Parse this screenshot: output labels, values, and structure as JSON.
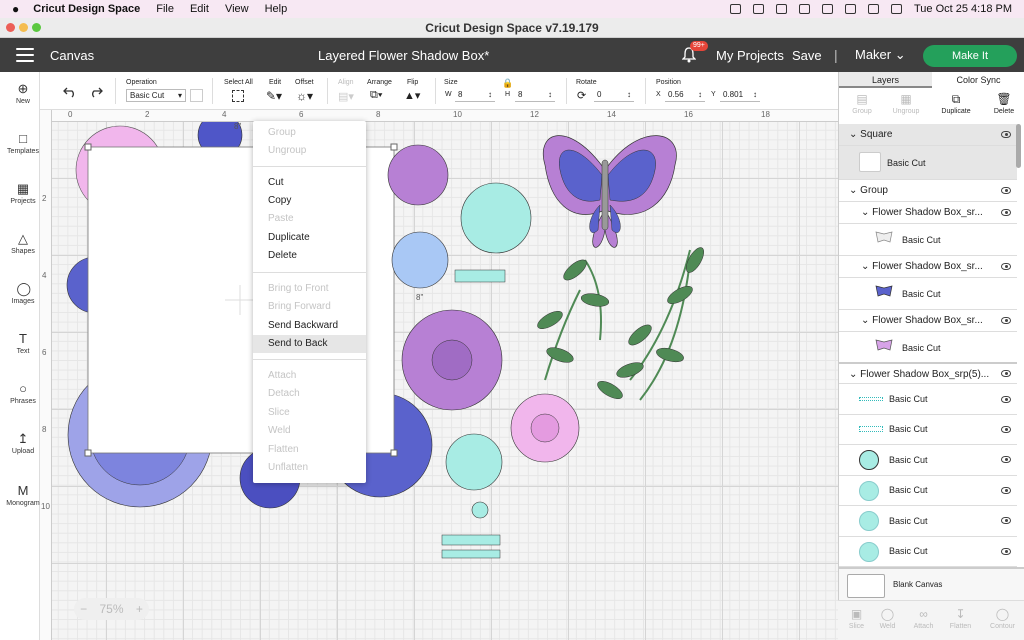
{
  "macmenu": {
    "app": "Cricut Design Space",
    "items": [
      "File",
      "Edit",
      "View",
      "Help"
    ],
    "clock": "Tue Oct 25  4:18 PM"
  },
  "window": {
    "title": "Cricut Design Space  v7.19.179"
  },
  "header": {
    "section": "Canvas",
    "project": "Layered Flower Shadow Box*",
    "badge": "99+",
    "my_projects": "My Projects",
    "save": "Save",
    "divider": "|",
    "machine": "Maker",
    "make_it": "Make It"
  },
  "toolbar": {
    "operation_label": "Operation",
    "operation_value": "Basic Cut",
    "select_all": "Select All",
    "edit": "Edit",
    "offset": "Offset",
    "align": "Align",
    "arrange": "Arrange",
    "flip": "Flip",
    "size": "Size",
    "w_label": "W",
    "w_value": "8",
    "h_label": "H",
    "h_value": "8",
    "rotate": "Rotate",
    "rotate_value": "0",
    "position": "Position",
    "x_label": "X",
    "x_value": "0.56",
    "y_label": "Y",
    "y_value": "0.801"
  },
  "rail": [
    "New",
    "Templates",
    "Projects",
    "Shapes",
    "Images",
    "Text",
    "Phrases",
    "Upload",
    "Monogram"
  ],
  "ruler": {
    "top": [
      "0",
      "2",
      "4",
      "6",
      "8",
      "10",
      "12",
      "14",
      "16",
      "18"
    ],
    "left": [
      "2",
      "4",
      "6",
      "8",
      "10"
    ]
  },
  "canvas": {
    "size_label_top": "8\"",
    "size_label_side": "8\""
  },
  "context_menu": [
    {
      "label": "Group",
      "enabled": false
    },
    {
      "label": "Ungroup",
      "enabled": false
    },
    {
      "label": "Cut",
      "enabled": true
    },
    {
      "label": "Copy",
      "enabled": true
    },
    {
      "label": "Paste",
      "enabled": false
    },
    {
      "label": "Duplicate",
      "enabled": true
    },
    {
      "label": "Delete",
      "enabled": true
    },
    {
      "label": "Bring to Front",
      "enabled": false
    },
    {
      "label": "Bring Forward",
      "enabled": false
    },
    {
      "label": "Send Backward",
      "enabled": true
    },
    {
      "label": "Send to Back",
      "enabled": true,
      "highlighted": true
    },
    {
      "label": "Attach",
      "enabled": false
    },
    {
      "label": "Detach",
      "enabled": false
    },
    {
      "label": "Slice",
      "enabled": false
    },
    {
      "label": "Weld",
      "enabled": false
    },
    {
      "label": "Flatten",
      "enabled": false
    },
    {
      "label": "Unflatten",
      "enabled": false
    }
  ],
  "zoom": {
    "value": "75%",
    "minus": "−",
    "plus": "+"
  },
  "panel": {
    "tabs": [
      "Layers",
      "Color Sync"
    ],
    "tools": [
      "Group",
      "Ungroup",
      "Duplicate",
      "Delete"
    ],
    "layers": {
      "square_title": "Square",
      "square_op": "Basic Cut",
      "group_title": "Group",
      "sub": [
        {
          "title": "Flower Shadow Box_sr...",
          "op": "Basic Cut"
        },
        {
          "title": "Flower Shadow Box_sr...",
          "op": "Basic Cut"
        },
        {
          "title": "Flower Shadow Box_sr...",
          "op": "Basic Cut"
        }
      ],
      "srp_title": "Flower Shadow Box_srp(5)...",
      "srp_items": [
        "Basic Cut",
        "Basic Cut",
        "Basic Cut",
        "Basic Cut",
        "Basic Cut",
        "Basic Cut"
      ]
    },
    "blank": "Blank Canvas",
    "bottom": [
      "Slice",
      "Weld",
      "Attach",
      "Flatten",
      "Contour"
    ]
  },
  "colors": {
    "accent_green": "#24a05b",
    "purple": "#b780d4",
    "blue": "#5a62cc",
    "mint": "#a8ece4",
    "lavender": "#9ea3e8",
    "pink": "#f1b6ec",
    "leaf": "#4f8a55"
  }
}
